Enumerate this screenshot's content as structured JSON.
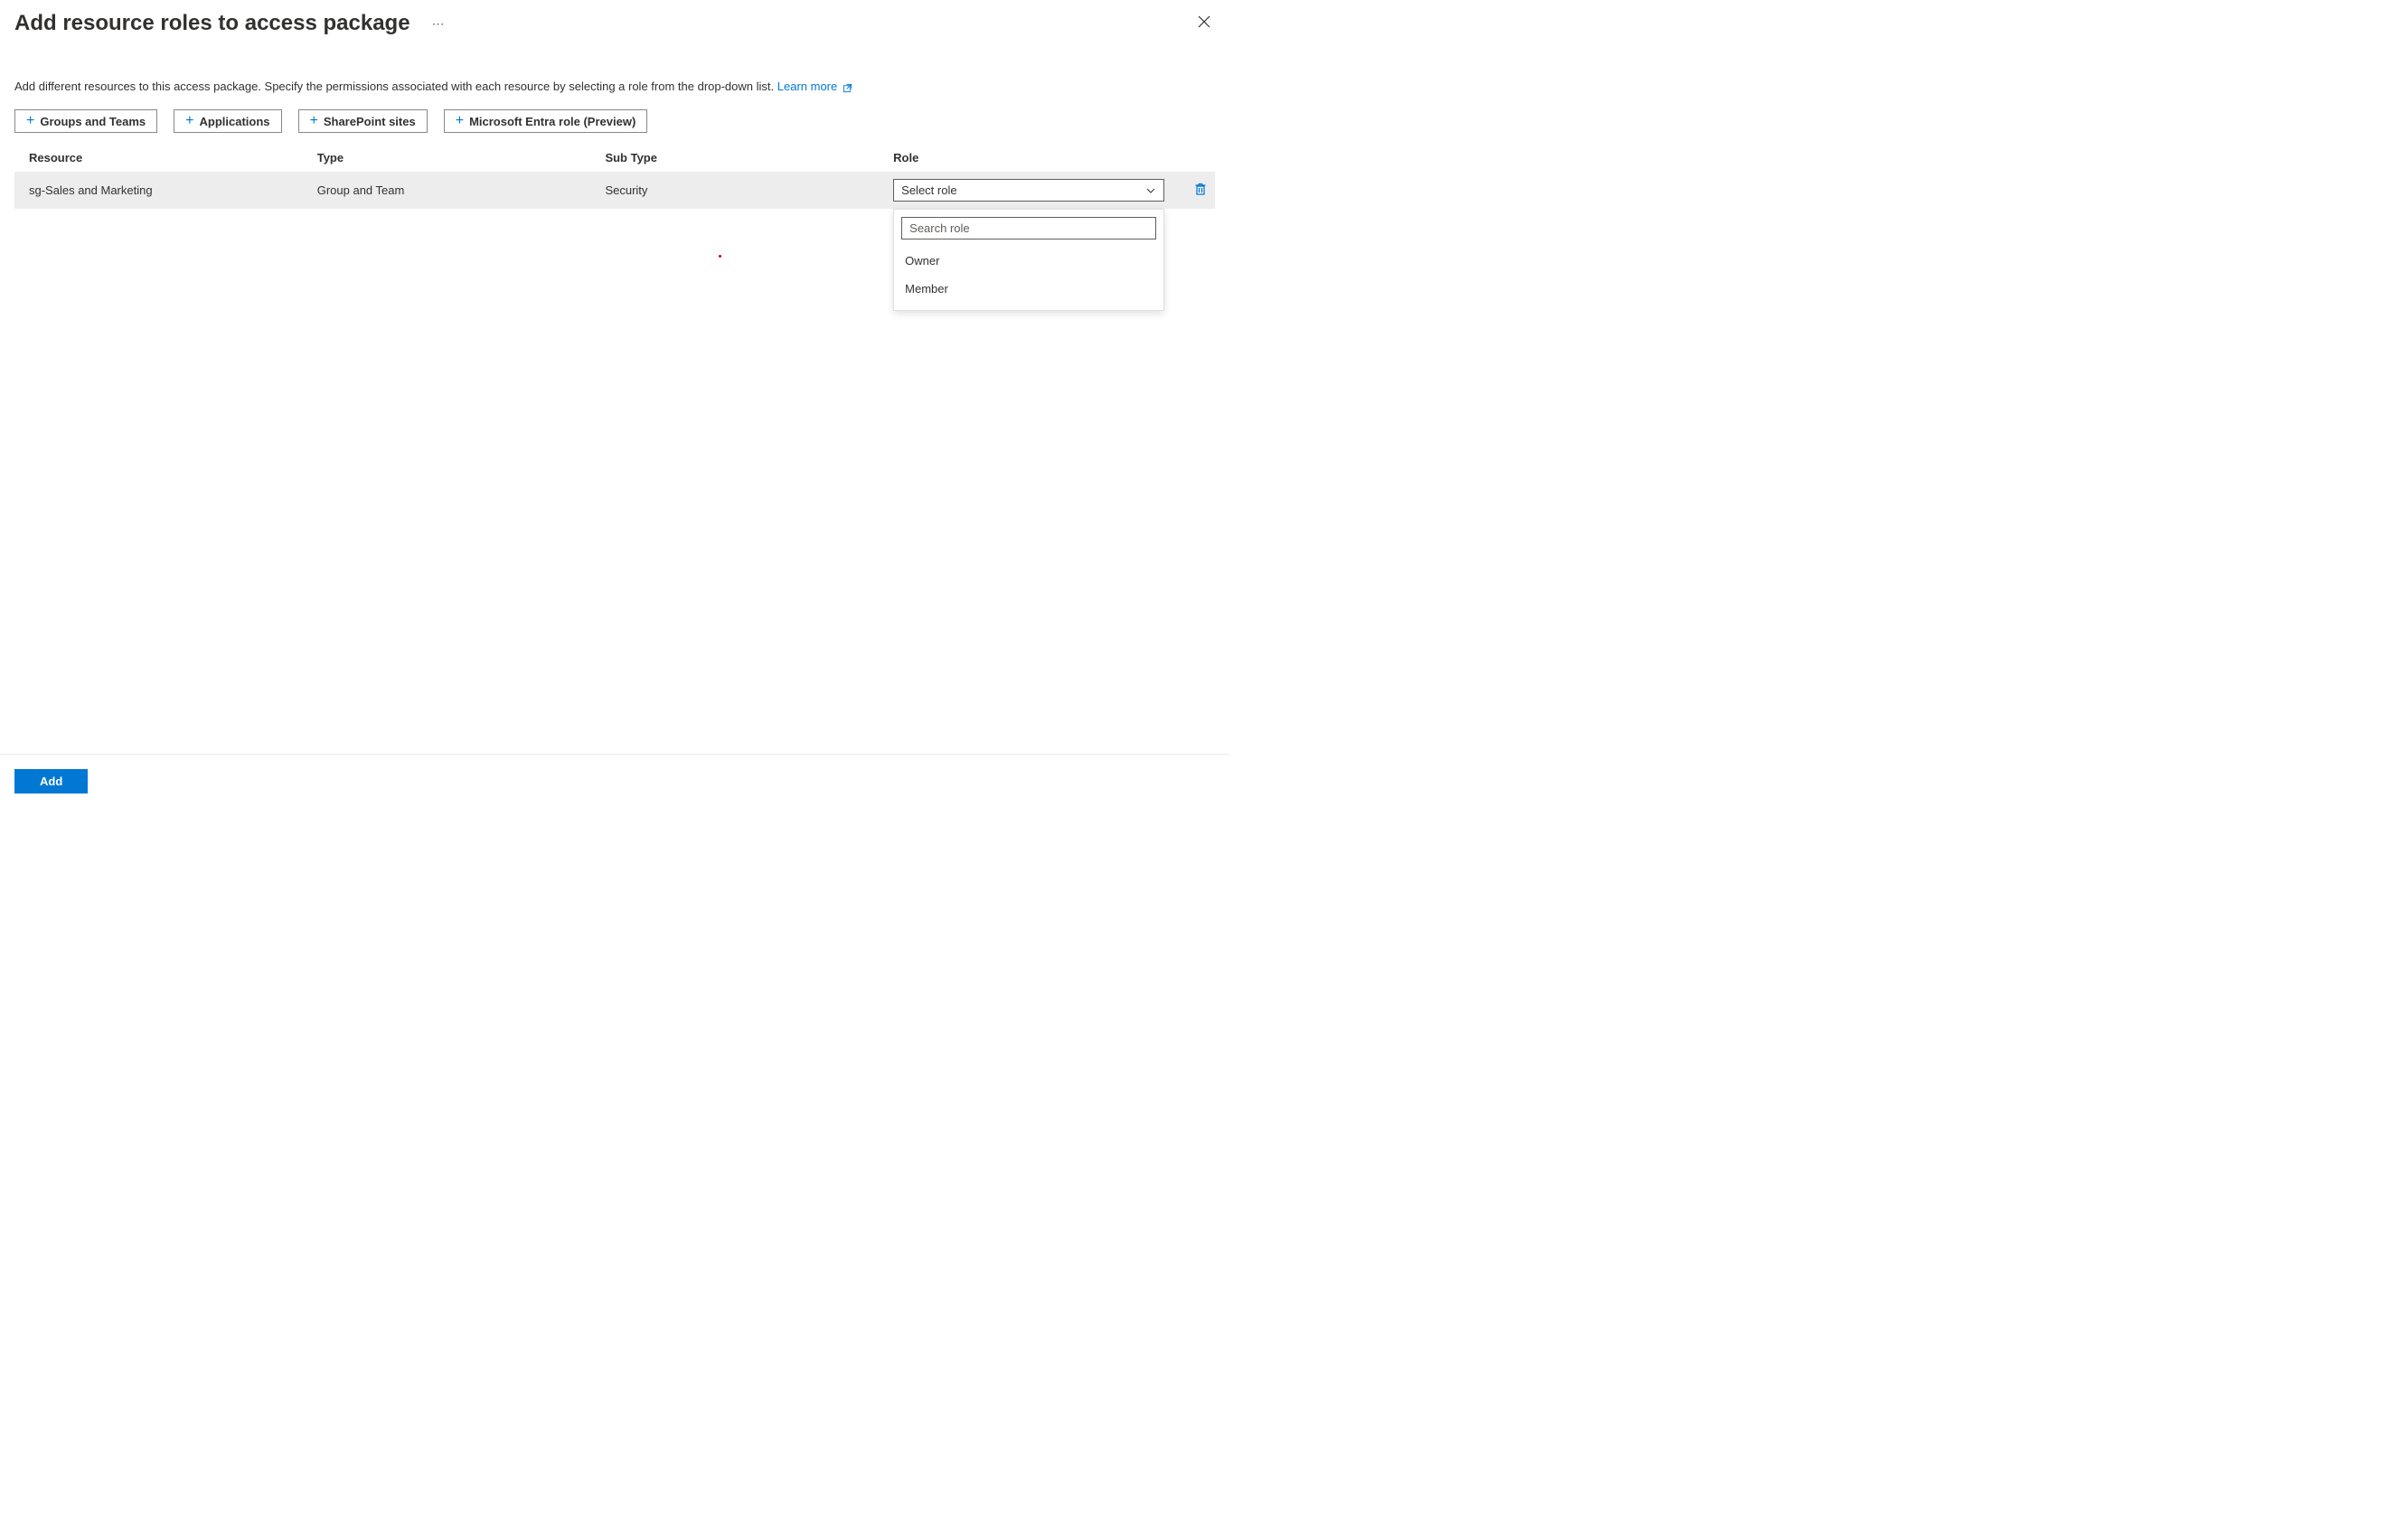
{
  "header": {
    "title": "Add resource roles to access package"
  },
  "description": {
    "text": "Add different resources to this access package. Specify the permissions associated with each resource by selecting a role from the drop-down list. ",
    "learn_more_label": "Learn more"
  },
  "toolbar": {
    "buttons": [
      {
        "label": "Groups and Teams"
      },
      {
        "label": "Applications"
      },
      {
        "label": "SharePoint sites"
      },
      {
        "label": "Microsoft Entra role (Preview)"
      }
    ]
  },
  "table": {
    "headers": {
      "resource": "Resource",
      "type": "Type",
      "subtype": "Sub Type",
      "role": "Role"
    },
    "rows": [
      {
        "resource": "sg-Sales and Marketing",
        "type": "Group and Team",
        "subtype": "Security",
        "role_placeholder": "Select role"
      }
    ]
  },
  "role_dropdown": {
    "search_placeholder": "Search role",
    "options": [
      "Owner",
      "Member"
    ]
  },
  "footer": {
    "primary_label": "Add"
  }
}
